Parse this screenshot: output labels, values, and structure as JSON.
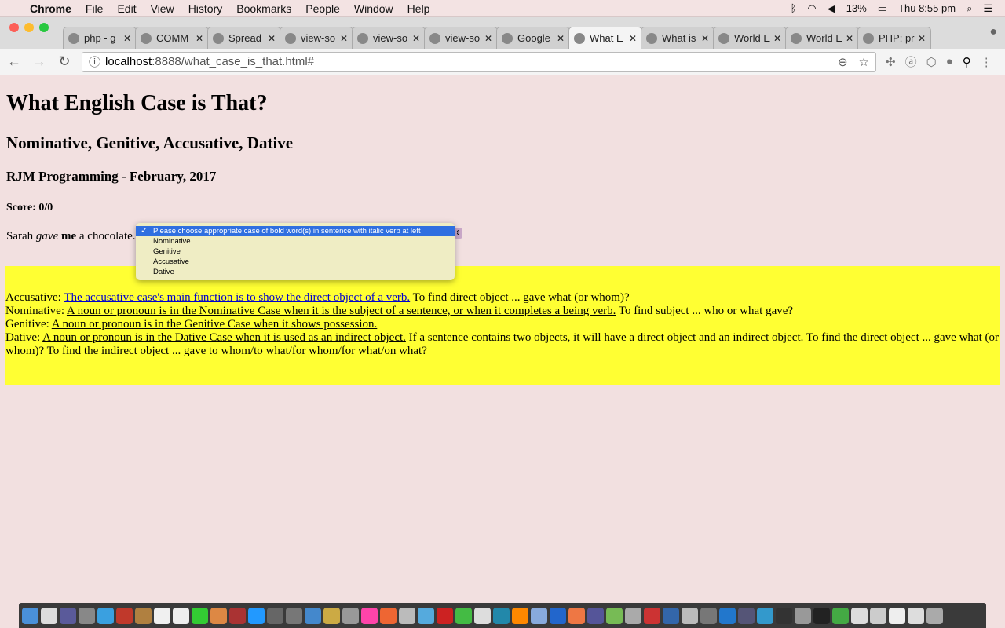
{
  "menubar": {
    "app": "Chrome",
    "items": [
      "File",
      "Edit",
      "View",
      "History",
      "Bookmarks",
      "People",
      "Window",
      "Help"
    ],
    "battery": "13%",
    "clock": "Thu 8:55 pm"
  },
  "tabs": [
    {
      "label": "php - g"
    },
    {
      "label": "COMM"
    },
    {
      "label": "Spread"
    },
    {
      "label": "view-so"
    },
    {
      "label": "view-so"
    },
    {
      "label": "view-so"
    },
    {
      "label": "Google"
    },
    {
      "label": "What E",
      "active": true
    },
    {
      "label": "What is"
    },
    {
      "label": "World E"
    },
    {
      "label": "World E"
    },
    {
      "label": "PHP: pr"
    }
  ],
  "address": {
    "host": "localhost",
    "rest": ":8888/what_case_is_that.html#"
  },
  "page": {
    "title": "What English Case is That?",
    "subtitle": "Nominative, Genitive, Accusative, Dative",
    "byline": "RJM Programming - February, 2017",
    "score": "Score: 0/0",
    "sentence": {
      "a": "Sarah ",
      "verb": "gave",
      "b": " ",
      "obj": "me",
      "c": " a chocolate."
    },
    "select": {
      "options": [
        "Please choose appropriate case of bold word(s) in sentence with italic verb at left",
        "Nominative",
        "Genitive",
        "Accusative",
        "Dative"
      ],
      "selected": "Please choose appropriate case of bold word(s) in sentence with italic verb at left"
    },
    "info": [
      {
        "label": "Accusative: ",
        "link": "The accusative case's main function is to show the direct object of a verb.",
        "text": " To find direct object ... gave what (or whom)?"
      },
      {
        "label": "Nominative: ",
        "link": "A noun or pronoun is in the Nominative Case when it is the subject of a sentence, or when it completes a being verb.",
        "text": " To find subject ... who or what gave?"
      },
      {
        "label": "Genitive: ",
        "link": "A noun or pronoun is in the Genitive Case when it shows possession.",
        "text": ""
      },
      {
        "label": "Dative: ",
        "link": "A noun or pronoun is in the Dative Case when it is used as an indirect object.",
        "text": " If a sentence contains two objects, it will have a direct object and an indirect object. To find the direct object ... gave what (or whom)? To find the indirect object ... gave to whom/to what/for whom/for what/on what?"
      }
    ]
  },
  "colors": {
    "page_bg": "#f2e0e0",
    "info_bg": "#ffff33",
    "link_visited": "#0000cc",
    "select_highlight": "#2f6fe0"
  }
}
